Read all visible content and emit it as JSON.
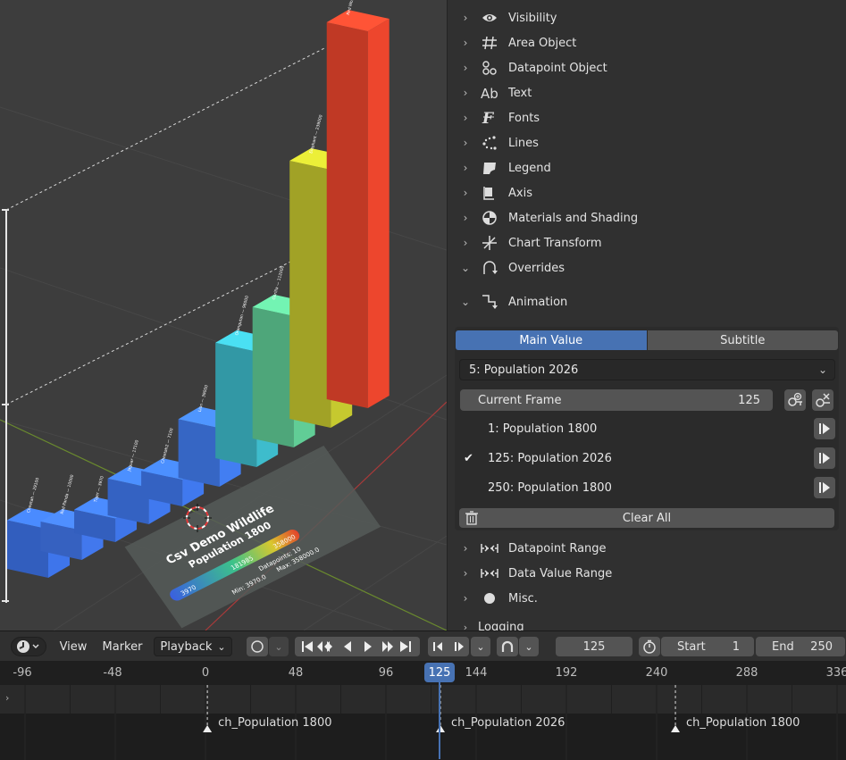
{
  "chart_data": {
    "type": "bar",
    "title": "Csv Demo Wildlife",
    "subtitle": "Population 1800",
    "legend_values": [
      "3970",
      "181985",
      "358000"
    ],
    "stats": {
      "datapoints": "Datapoints: 10",
      "min": "Min: 3970.0",
      "max": "Max: 358000.0"
    },
    "categories": [
      "Cheetah",
      "Red Panda",
      "Tiger",
      "Jaguar",
      "Cheetah2",
      "Lion",
      "Orangutan",
      "Gorilla",
      "Elephant",
      "Red Wolf"
    ],
    "values": [
      29100,
      10000,
      3970,
      17100,
      7100,
      39000,
      96000,
      112000,
      239000,
      358000
    ],
    "colors": [
      "#3b6fe0",
      "#3f72e2",
      "#3c70df",
      "#3d73e4",
      "#3d73e4",
      "#3f78e6",
      "#3bb3c2",
      "#5cc38f",
      "#bdbf2d",
      "#e2432b"
    ]
  },
  "properties": {
    "sections": [
      {
        "label": "Visibility",
        "icon": "eye-icon",
        "open": false
      },
      {
        "label": "Area Object",
        "icon": "grid-icon",
        "open": false
      },
      {
        "label": "Datapoint Object",
        "icon": "datapoint-icon",
        "open": false
      },
      {
        "label": "Text",
        "icon": "text-icon",
        "open": false
      },
      {
        "label": "Fonts",
        "icon": "font-icon",
        "open": false
      },
      {
        "label": "Lines",
        "icon": "lines-icon",
        "open": false
      },
      {
        "label": "Legend",
        "icon": "legend-icon",
        "open": false
      },
      {
        "label": "Axis",
        "icon": "axis-icon",
        "open": false
      },
      {
        "label": "Materials and Shading",
        "icon": "material-icon",
        "open": false
      },
      {
        "label": "Chart Transform",
        "icon": "transform-icon",
        "open": false
      },
      {
        "label": "Overrides",
        "icon": "override-icon",
        "open": true
      },
      {
        "label": "Animation",
        "icon": "animation-icon",
        "open": true
      }
    ],
    "tabs": {
      "main": "Main Value",
      "subtitle": "Subtitle"
    },
    "dropdown_value": "5: Population 2026",
    "current_frame_label": "Current Frame",
    "current_frame_value": "125",
    "keyframes": [
      {
        "label": "1: Population 1800",
        "checked": false
      },
      {
        "label": "125: Population 2026",
        "checked": true
      },
      {
        "label": "250: Population 1800",
        "checked": false
      }
    ],
    "clear_all": "Clear All",
    "more_sections": [
      {
        "label": "Datapoint Range",
        "icon": "range-icon"
      },
      {
        "label": "Data Value Range",
        "icon": "range-icon"
      },
      {
        "label": "Misc.",
        "icon": "circle-icon"
      }
    ],
    "logging": "Logging"
  },
  "timeline": {
    "menus": {
      "view": "View",
      "marker": "Marker",
      "playback": "Playback"
    },
    "frame": "125",
    "start_label": "Start",
    "start_value": "1",
    "end_label": "End",
    "end_value": "250",
    "ruler": [
      "-96",
      "-48",
      "0",
      "48",
      "96",
      "144",
      "192",
      "240",
      "288",
      "336"
    ],
    "current": "125",
    "markers": [
      "ch_Population 1800",
      "ch_Population 2026",
      "ch_Population 1800"
    ]
  }
}
